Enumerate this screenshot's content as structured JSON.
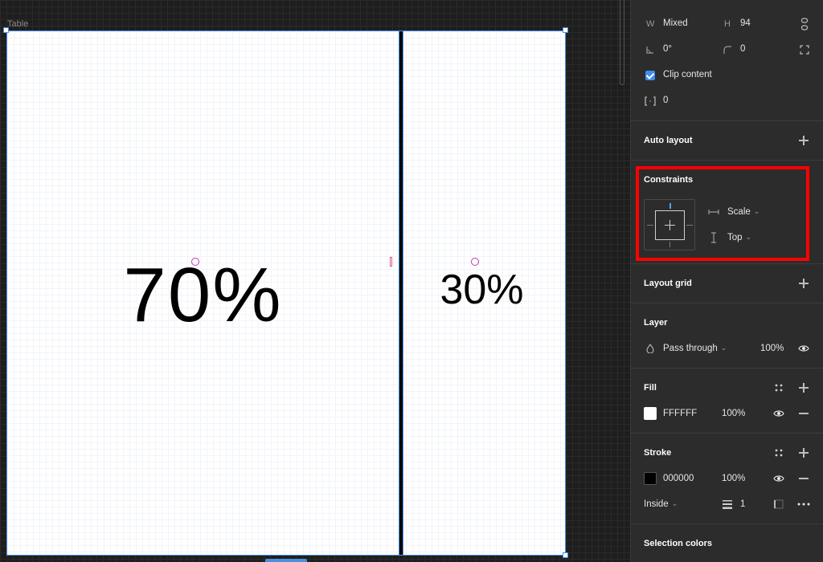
{
  "canvas": {
    "frame_label": "Table",
    "left_cell_text": "70%",
    "right_cell_text": "30%"
  },
  "design": {
    "w_label": "W",
    "w_value": "Mixed",
    "h_label": "H",
    "h_value": "94",
    "rotation_value": "0°",
    "corner_radius_value": "0",
    "clip_content_label": "Clip content",
    "clip_content_checked": true,
    "spacing_value": "0",
    "auto_layout_title": "Auto layout",
    "constraints_title": "Constraints",
    "horizontal_constraint": "Scale",
    "vertical_constraint": "Top",
    "layout_grid_title": "Layout grid",
    "layer_title": "Layer",
    "blend_mode": "Pass through",
    "layer_opacity": "100%",
    "fill_title": "Fill",
    "fill_color_hex": "FFFFFF",
    "fill_color": "#FFFFFF",
    "fill_opacity": "100%",
    "stroke_title": "Stroke",
    "stroke_color_hex": "000000",
    "stroke_color": "#000000",
    "stroke_opacity": "100%",
    "stroke_position": "Inside",
    "stroke_weight": "1",
    "selection_colors_title": "Selection colors"
  },
  "colors": {
    "accent": "#4A90E2",
    "highlight_box": "#FF0000",
    "panel_bg": "#2C2C2C",
    "canvas_bg": "#1E1E1E"
  }
}
